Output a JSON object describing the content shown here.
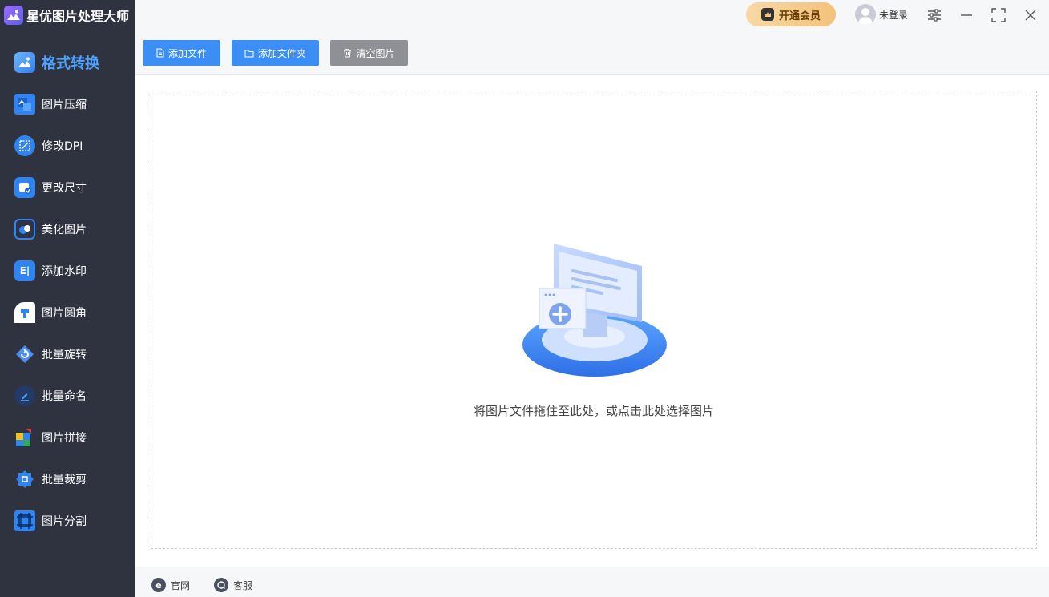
{
  "app": {
    "title": "星优图片处理大师"
  },
  "sidebar": {
    "items": [
      {
        "label": "格式转换",
        "icon": "format-convert-icon",
        "active": true
      },
      {
        "label": "图片压缩",
        "icon": "compress-icon"
      },
      {
        "label": "修改DPI",
        "icon": "dpi-icon"
      },
      {
        "label": "更改尺寸",
        "icon": "resize-icon"
      },
      {
        "label": "美化图片",
        "icon": "beautify-icon"
      },
      {
        "label": "添加水印",
        "icon": "watermark-icon"
      },
      {
        "label": "图片圆角",
        "icon": "round-corner-icon"
      },
      {
        "label": "批量旋转",
        "icon": "rotate-icon"
      },
      {
        "label": "批量命名",
        "icon": "rename-icon"
      },
      {
        "label": "图片拼接",
        "icon": "splice-icon"
      },
      {
        "label": "批量裁剪",
        "icon": "crop-icon"
      },
      {
        "label": "图片分割",
        "icon": "split-icon"
      }
    ]
  },
  "header": {
    "vip_label": "开通会员",
    "user_label": "未登录"
  },
  "toolbar": {
    "add_file_label": "添加文件",
    "add_folder_label": "添加文件夹",
    "clear_label": "清空图片"
  },
  "main": {
    "drop_hint": "将图片文件拖住至此处，或点击此处选择图片"
  },
  "footer": {
    "website_label": "官网",
    "support_label": "客服"
  },
  "colors": {
    "sidebar_bg": "#2f3340",
    "accent": "#3a8ef6",
    "active_text": "#4fa3ff",
    "clear_button": "#8d9095",
    "vip_gold": "#f3c27a"
  }
}
